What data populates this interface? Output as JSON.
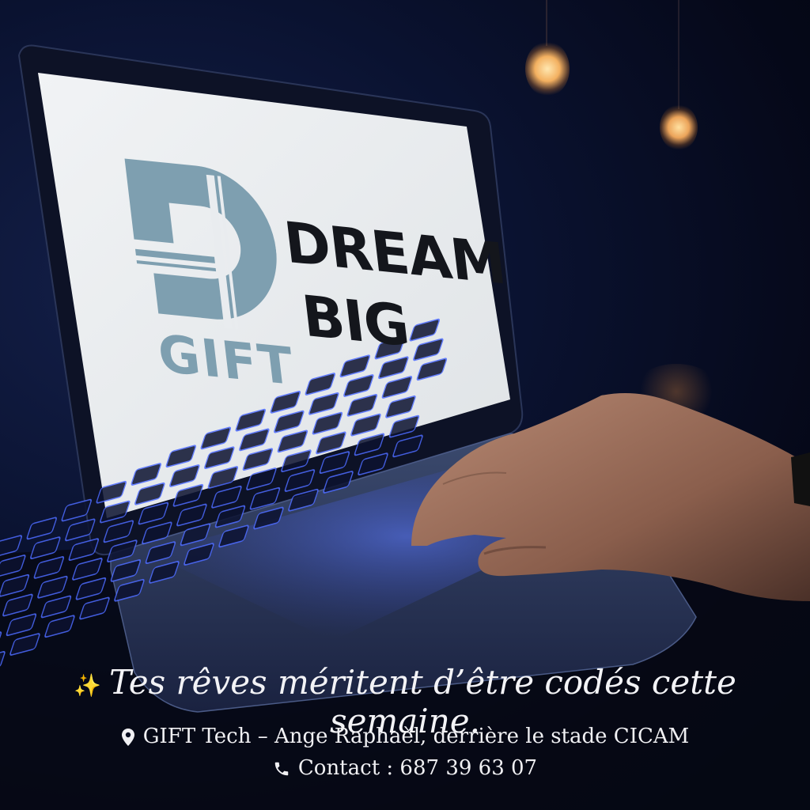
{
  "screen": {
    "logo_text": "GIFT",
    "headline_line1": "DREAM",
    "headline_line2": "BIG"
  },
  "caption": {
    "tagline": "Tes rêves méritent d’être codés cette semaine.",
    "address": "GIFT Tech – Ange Raphaèl, derrière le stade CICAM",
    "contact": "Contact : 687 39 63 07"
  },
  "icons": {
    "tagline": "sparkle-icon",
    "address": "map-pin-icon",
    "contact": "phone-icon"
  },
  "colors": {
    "background": "#070b1a",
    "logo": "#7e9fb0",
    "headline": "#14161c",
    "screen": "#e9ecef",
    "key_glow": "#4d6bff",
    "caption_text": "#f3f3f6"
  }
}
